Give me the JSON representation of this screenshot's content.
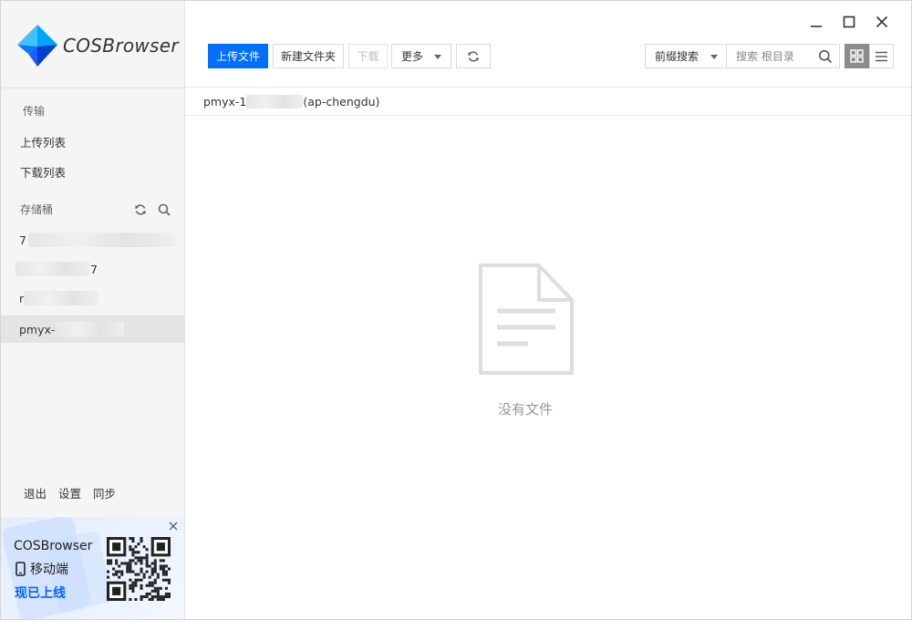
{
  "app": {
    "name": "COSBrowser",
    "brand_color": "#006eff"
  },
  "sidebar": {
    "transfer_section": "传输",
    "upload_list": "上传列表",
    "download_list": "下载列表",
    "bucket_section": "存储桶",
    "buckets": [
      {
        "prefix": "7",
        "suffix": ""
      },
      {
        "prefix": "",
        "suffix": "7"
      },
      {
        "prefix": "r",
        "suffix": ""
      },
      {
        "prefix": "pmyx-",
        "suffix": ""
      }
    ],
    "bottom_links": [
      "退出",
      "设置",
      "同步"
    ]
  },
  "promo": {
    "title": "COSBrowser",
    "mobile": "移动端",
    "online": "现已上线"
  },
  "toolbar": {
    "upload": "上传文件",
    "new_folder": "新建文件夹",
    "download": "下载",
    "more": "更多",
    "search_scope": "前缀搜索",
    "search_placeholder": "搜索 根目录"
  },
  "breadcrumb": {
    "prefix": "pmyx-1",
    "region": "(ap-chengdu)"
  },
  "empty": {
    "message": "没有文件",
    "icon": "empty-file-icon"
  },
  "icons": {
    "refresh": "refresh-icon",
    "search": "search-icon",
    "grid": "grid-view-icon",
    "list": "list-view-icon",
    "close": "close-icon",
    "minimize": "minimize-icon",
    "maximize": "maximize-icon",
    "phone": "phone-icon",
    "qr": "qr-code-icon"
  }
}
